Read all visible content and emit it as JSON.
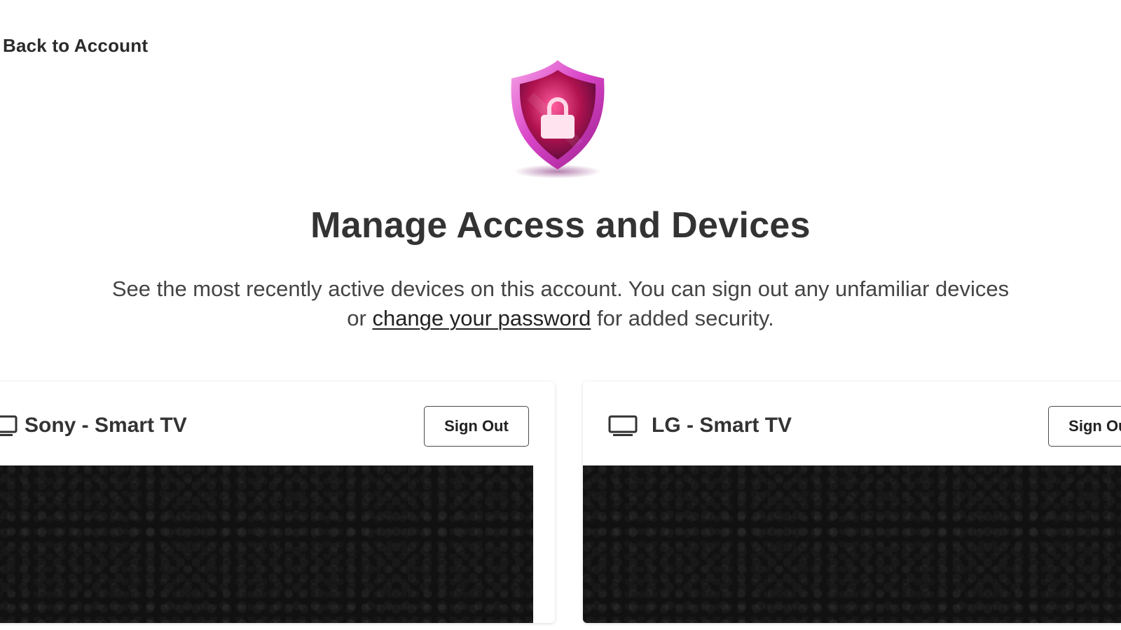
{
  "nav": {
    "back_label": "Back to Account"
  },
  "header": {
    "icon": "shield-lock-icon",
    "title": "Manage Access and Devices",
    "description_before": "See the most recently active devices on this account. You can sign out any unfamiliar devices or ",
    "description_link": "change your password",
    "description_after": " for added security."
  },
  "devices": [
    {
      "name": "Sony - Smart TV",
      "icon": "tv-icon",
      "signout_label": "Sign Out"
    },
    {
      "name": "LG - Smart TV",
      "icon": "tv-icon",
      "signout_label": "Sign Out"
    }
  ],
  "colors": {
    "shield_primary": "#c2185b",
    "shield_accent": "#e040fb",
    "preview_bg": "#111111",
    "text": "#333333"
  }
}
